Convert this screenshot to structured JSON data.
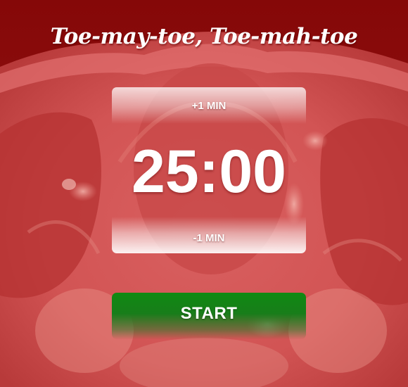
{
  "app": {
    "title": "Toe-may-toe, Toe-mah-toe"
  },
  "timer": {
    "increment_label": "+1 MIN",
    "display": "25:00",
    "decrement_label": "-1 MIN"
  },
  "controls": {
    "start_label": "START"
  },
  "colors": {
    "background_dark": "#8b0a0a",
    "background_light": "#d95858",
    "start_button": "#0f8a12",
    "text": "#ffffff"
  },
  "background_image": {
    "subject": "tomato-cross-section"
  }
}
